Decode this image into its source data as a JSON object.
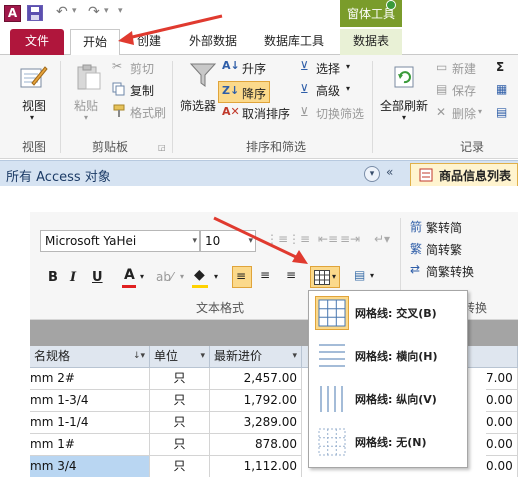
{
  "qat": {
    "app_letter": "A",
    "undo": "↶",
    "redo": "↷",
    "more": "▾"
  },
  "context_tab_header": "窗体工具",
  "tabs": [
    {
      "label": "文件"
    },
    {
      "label": "开始"
    },
    {
      "label": "创建"
    },
    {
      "label": "外部数据"
    },
    {
      "label": "数据库工具"
    },
    {
      "label": "数据表"
    }
  ],
  "ribbon1": {
    "view": {
      "label": "视图",
      "group": "视图"
    },
    "clipboard": {
      "paste": "粘贴",
      "cut": "剪切",
      "copy": "复制",
      "format_painter": "格式刷",
      "group": "剪贴板"
    },
    "sort_filter": {
      "filter": "筛选器",
      "asc": "升序",
      "desc": "降序",
      "clear_sort": "取消排序",
      "select": "选择",
      "advanced": "高级",
      "toggle_filter": "切换筛选",
      "group": "排序和筛选"
    },
    "records": {
      "refresh_all": "全部刷新",
      "new": "新建",
      "save": "保存",
      "delete": "删除",
      "group": "记录",
      "sum_symbol": "Σ"
    }
  },
  "navbar": {
    "title": "所有 Access 对象",
    "doc_tab": "商品信息列表"
  },
  "ribbon2": {
    "font_name": "Microsoft YaHei",
    "font_size": "10",
    "bold": "B",
    "italic": "I",
    "underline": "U",
    "font_color_letter": "A",
    "group": "文本格式",
    "chinese": {
      "trad_to_simp": "繁转简",
      "simp_to_trad": "简转繁",
      "convert": "简繁转换",
      "partial": "转换"
    }
  },
  "table": {
    "columns": [
      {
        "label": "名规格"
      },
      {
        "label": "单位"
      },
      {
        "label": "最新进价"
      },
      {
        "label": ""
      }
    ],
    "rows": [
      {
        "c0": "mm 2#",
        "c1": "只",
        "c2": "2,457.00",
        "c3": "7.00"
      },
      {
        "c0": "mm 1-3/4",
        "c1": "只",
        "c2": "1,792.00",
        "c3": "0.00"
      },
      {
        "c0": "mm 1-1/4",
        "c1": "只",
        "c2": "3,289.00",
        "c3": "0.00"
      },
      {
        "c0": "mm 1#",
        "c1": "只",
        "c2": "878.00",
        "c3": "0.00"
      },
      {
        "c0": "mm 3/4",
        "c1": "只",
        "c2": "1,112.00",
        "c3": "0.00"
      }
    ]
  },
  "gridlines_menu": {
    "items": [
      {
        "label": "网格线: 交叉(B)"
      },
      {
        "label": "网格线: 横向(H)"
      },
      {
        "label": "网格线: 纵向(V)"
      },
      {
        "label": "网格线: 无(N)"
      }
    ]
  },
  "colors": {
    "file_tab": "#b0163c",
    "context_green": "#7a9c2b",
    "highlight": "#fbd98b",
    "arrow_red": "#e03a2f"
  }
}
